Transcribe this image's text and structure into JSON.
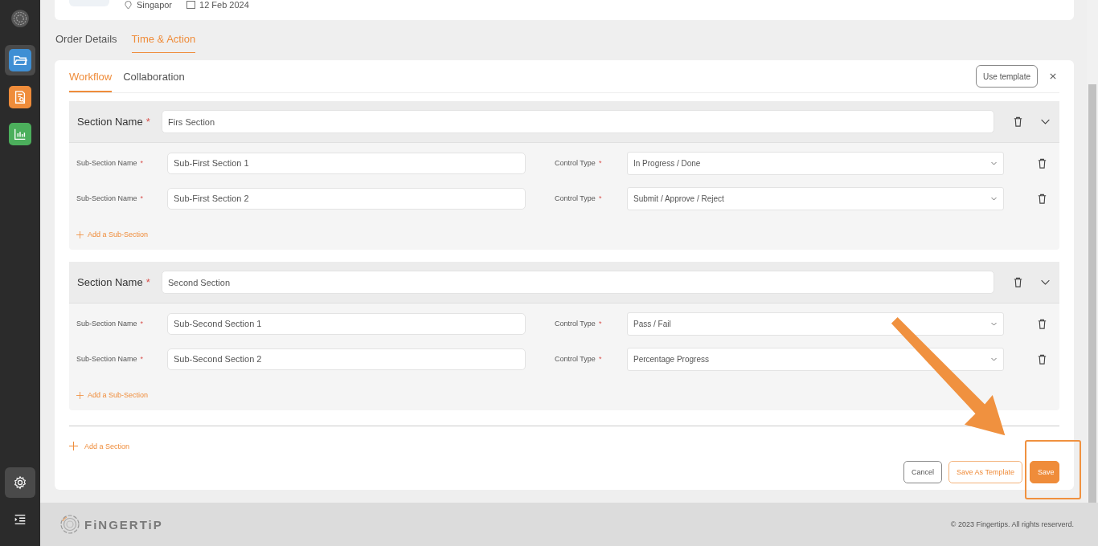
{
  "sidebar": {
    "items": [
      {
        "kind": "folder",
        "color": "#3f8fd4",
        "selected": true
      },
      {
        "kind": "report",
        "color": "#ef8c3a",
        "selected": false
      },
      {
        "kind": "chart",
        "color": "#4caf5c",
        "selected": false
      }
    ],
    "bottom_items": [
      {
        "kind": "settings",
        "selected": true
      },
      {
        "kind": "menu",
        "selected": false
      }
    ]
  },
  "order_header": {
    "location": "Singapor",
    "date": "12 Feb 2024"
  },
  "page_tabs": [
    {
      "label": "Order Details",
      "selected": false
    },
    {
      "label": "Time & Action",
      "selected": true
    }
  ],
  "workflow_card": {
    "tabs": [
      {
        "label": "Workflow",
        "selected": true
      },
      {
        "label": "Collaboration",
        "selected": false
      }
    ],
    "use_template_button": "Use template",
    "sections": [
      {
        "label": "Section Name",
        "required_mark": "*",
        "value": "Firs Section",
        "expanded": true,
        "subsections": [
          {
            "label": "Sub-Section Name",
            "required_mark": "*",
            "value": "Sub-First Section 1",
            "control_label": "Control Type",
            "control_required_mark": "*",
            "control_value": "In Progress / Done"
          },
          {
            "label": "Sub-Section Name",
            "required_mark": "*",
            "value": "Sub-First Section 2",
            "control_label": "Control Type",
            "control_required_mark": "*",
            "control_value": "Submit / Approve / Reject"
          }
        ],
        "add_subsection": "Add a Sub-Section"
      },
      {
        "label": "Section Name",
        "required_mark": "*",
        "value": "Second Section",
        "expanded": true,
        "subsections": [
          {
            "label": "Sub-Section Name",
            "required_mark": "*",
            "value": "Sub-Second Section 1",
            "control_label": "Control Type",
            "control_required_mark": "*",
            "control_value": "Pass / Fail"
          },
          {
            "label": "Sub-Section Name",
            "required_mark": "*",
            "value": "Sub-Second Section 2",
            "control_label": "Control Type",
            "control_required_mark": "*",
            "control_value": "Percentage Progress"
          }
        ],
        "add_subsection": "Add a Sub-Section"
      }
    ],
    "add_section": "Add a Section",
    "buttons": [
      {
        "label": "Cancel",
        "kind": "outline"
      },
      {
        "label": "Save As Template",
        "kind": "accent-outline"
      },
      {
        "label": "Save",
        "kind": "primary"
      }
    ]
  },
  "footer": {
    "brand": "FiNGERTiP",
    "copyright": "© 2023 Fingertips. All rights reserverd."
  }
}
